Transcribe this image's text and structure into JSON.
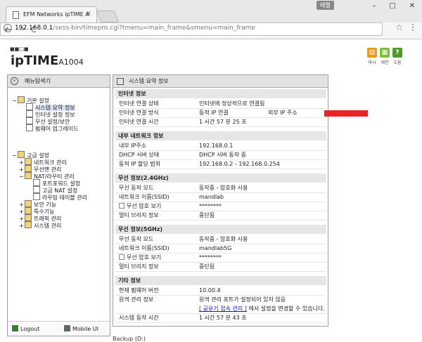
{
  "browser": {
    "tab_title": "EFM Networks ipTIME A",
    "tab_close": "×",
    "badge": "테멜",
    "win_min": "–",
    "win_max": "□",
    "win_close": "✕",
    "nav_back": "←",
    "nav_forward": "→",
    "nav_reload": "C",
    "url_host": "192.168.0.1",
    "url_path": "/sess-bin/timepro.cgi?tmenu=main_frame&smenu=main_frame",
    "star": "☆",
    "menu": "⋮"
  },
  "header": {
    "logo_squares": "■■□■",
    "logo": "ipTIME",
    "model": "A1004",
    "icons": [
      {
        "name": "save-icon",
        "label": "마시",
        "color": "#e89a1a",
        "glyph": "▤"
      },
      {
        "name": "restart-icon",
        "label": "재찬",
        "color": "#7cbf3a",
        "glyph": "▦"
      },
      {
        "name": "help-icon",
        "label": "도움",
        "color": "#4f9a2a",
        "glyph": "?"
      }
    ]
  },
  "left": {
    "title": "메뉴탐색기",
    "tree": {
      "basic": "기본 설정",
      "sys_summary": "시스템 요약 정보",
      "internet": "인터넷 설정 정보",
      "wireless": "무선 설정/보안",
      "firmware": "펌웨어 업그레이드",
      "advanced": "고급 설정",
      "network": "네트워크 관리",
      "wlan_mgmt": "무선랜 관리",
      "nat": "NAT/라우터 관리",
      "portfwd": "포트포워드 설정",
      "adv_nat": "고급 NAT 설정",
      "routing": "라우팅 테이블 관리",
      "security": "보안 기능",
      "special": "특수기능",
      "traffic": "트래픽 관리",
      "sysmgmt": "시스템 관리"
    },
    "logout": "Logout",
    "mobile": "Mobile UI"
  },
  "right": {
    "title": "시스템 요약 정보",
    "internet": {
      "title": "인터넷 정보",
      "status_k": "인터넷 연결 상태",
      "status_v": "인터넷에 정상적으로 연결됨",
      "method_k": "인터넷 연결 방식",
      "method_v": "동적 IP 연결",
      "ext_ip_k": "외부 IP 주소",
      "time_k": "인터넷 연결 시간",
      "time_v": "1 시간 57 분 25 초"
    },
    "lan": {
      "title": "내부 네트워크 정보",
      "ip_k": "내부 IP주소",
      "ip_v": "192.168.0.1",
      "dhcp_k": "DHCP 서버 상태",
      "dhcp_v": "DHCP 서버 동작 중",
      "range_k": "동적 IP 할당 범위",
      "range_v": "192.168.0.2 -  192.168.0.254"
    },
    "w24": {
      "title": "무선 정보(2.4GHz)",
      "mode_k": "무선 동작 모드",
      "mode_v": "동작중 - 암호화 사용",
      "ssid_k": "네트워크 이름(SSID)",
      "ssid_v": "mandlab",
      "pw_k": "무선 암호 보기",
      "pw_v": "********",
      "bridge_k": "멀티 브리지 정보",
      "bridge_v": "중단됨"
    },
    "w5": {
      "title": "무선 정보(5GHz)",
      "mode_k": "무선 동작 모드",
      "mode_v": "동작중 - 암호화 사용",
      "ssid_k": "네트워크 이름(SSID)",
      "ssid_v": "mandlab5G",
      "pw_k": "무선 암호 보기",
      "pw_v": "********",
      "bridge_k": "멀티 브리지 정보",
      "bridge_v": "중단됨"
    },
    "etc": {
      "title": "기타 정보",
      "fw_k": "현재 펌웨어 버전",
      "fw_v": "10.00.4",
      "remote_k": "원격 관리 정보",
      "remote_v": "원격 관리 포트가 설정되어 있지 않음",
      "link": "[ 공유기 접속 관리 ]",
      "link_suffix": " 에서 설정을 변경할 수 있습니다.",
      "uptime_k": "시스템 동작 시간",
      "uptime_v": "1 시간 57 분 43 초"
    }
  },
  "bottom_peek": "Backup (D:)"
}
